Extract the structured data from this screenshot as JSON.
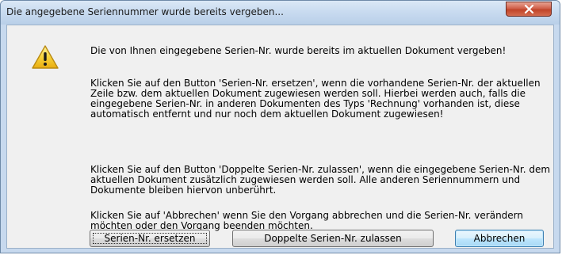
{
  "window": {
    "title": "Die angegebene Seriennummer wurde bereits vergeben..."
  },
  "message": {
    "paragraph1": "Die von Ihnen eingegebene Serien-Nr. wurde bereits im aktuellen Dokument vergeben!",
    "paragraph2": "Klicken Sie auf den Button 'Serien-Nr. ersetzen', wenn die vorhandene Serien-Nr. der aktuellen Zeile bzw. dem aktuellen Dokument zugewiesen werden soll. Hierbei werden auch, falls die eingegebene Serien-Nr. in anderen Dokumenten des Typs 'Rechnung' vorhanden ist, diese automatisch entfernt und nur noch dem aktuellen Dokument zugewiesen!",
    "paragraph3": "Klicken Sie auf den Button 'Doppelte Serien-Nr. zulassen', wenn die eingegebene Serien-Nr. dem aktuellen Dokument zusätzlich zugewiesen werden soll. Alle anderen Seriennummern und Dokumente bleiben hiervon unberührt.",
    "paragraph4": "Klicken Sie auf 'Abbrechen' wenn Sie den Vorgang abbrechen und die Serien-Nr. verändern möchten oder den Vorgang beenden möchten."
  },
  "buttons": {
    "replace_label": "Serien-Nr. ersetzen",
    "allow_duplicate_label": "Doppelte Serien-Nr. zulassen",
    "cancel_label": "Abbrechen"
  },
  "icons": {
    "dialog_icon": "warning-icon",
    "close_icon": "close-icon"
  },
  "colors": {
    "titlebar": "#c9dbf0",
    "close_button": "#c14429",
    "dialog_background": "#f0f0f0",
    "default_button_border": "#3c7fb1"
  }
}
